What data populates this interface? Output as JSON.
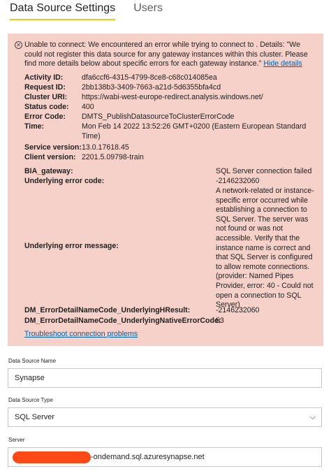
{
  "tabs": [
    "Data Source Settings",
    "Users"
  ],
  "error": {
    "icon": "error-circle-icon",
    "message": "Unable to connect: We encountered an error while trying to connect to . Details: \"We could not register this data source for any gateway instances within this cluster. Please find more details below about specific errors for each gateway instance.\"",
    "hide_details": "Hide details",
    "details": [
      {
        "key": "Activity ID:",
        "value": "dfa6ccf6-4315-4799-8ce8-c68c014085ea"
      },
      {
        "key": "Request ID:",
        "value": "2bb138b3-3409-7663-a21d-5d6355bfa4cd"
      },
      {
        "key": "Cluster URI:",
        "value": "https://wabi-west-europe-redirect.analysis.windows.net/"
      },
      {
        "key": "Status code:",
        "value": "400"
      },
      {
        "key": "Error Code:",
        "value": "DMTS_PublishDatasourceToClusterErrorCode"
      },
      {
        "key": "Time:",
        "value": "Mon Feb 14 2022 13:52:26 GMT+0200 (Eastern European Standard Time)"
      },
      {
        "key": "Service version:",
        "value": "13.0.17618.45"
      },
      {
        "key": "Client version:",
        "value": "2201.5.09798-train"
      }
    ],
    "gateway_key": "BIA_gateway:",
    "gateway_value": "SQL Server connection failed",
    "underlying_code_key": "Underlying error code:",
    "underlying_code_value": "-2146232060",
    "underlying_msg_key": "Underlying error message:",
    "underlying_msg_value": "A network-related or instance-specific error occurred while establishing a connection to SQL Server. The server was not found or was not accessible. Verify that the instance name is correct and that SQL Server is configured to allow remote connections. (provider: Named Pipes Provider, error: 40 - Could not open a connection to SQL Server)",
    "hresult_key": "DM_ErrorDetailNameCode_UnderlyingHResult:",
    "hresult_value": "-2146232060",
    "native_key": "DM_ErrorDetailNameCode_UnderlyingNativeErrorCode:",
    "native_value": "53",
    "troubleshoot": "Troubleshoot connection problems"
  },
  "form": {
    "name_label": "Data Source Name",
    "name_value": "Synapse",
    "type_label": "Data Source Type",
    "type_value": "SQL Server",
    "server_label": "Server",
    "server_value": "-ondemand.sql.azuresynapse.net"
  },
  "colors": {
    "error_bg": "#f5d1ca",
    "link": "#0063b1",
    "tab_underline": "#f2c811",
    "redaction": "#ff4a17"
  }
}
